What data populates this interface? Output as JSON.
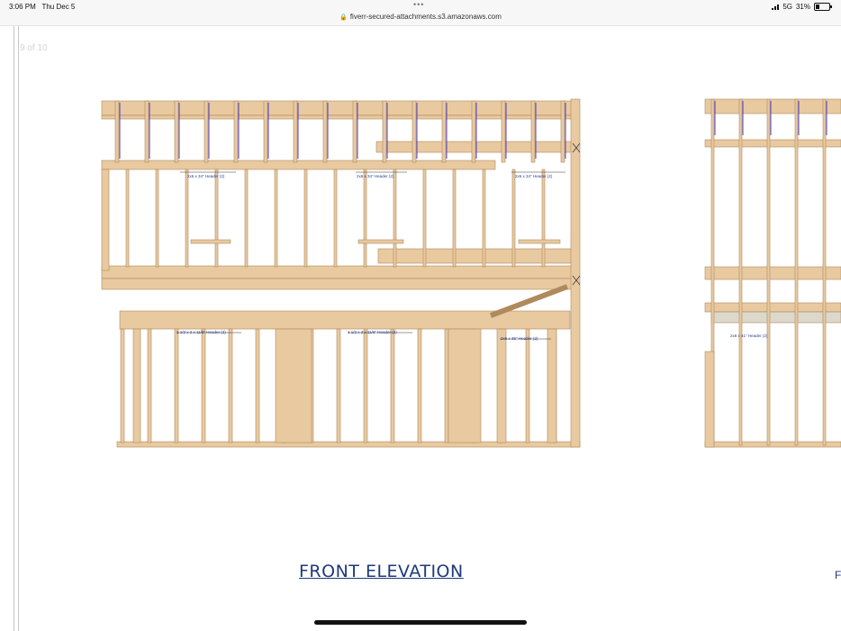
{
  "status_bar": {
    "time": "3:06 PM",
    "date": "Thu Dec 5",
    "network": "5G",
    "battery": "31%",
    "battery_level": 0.31
  },
  "browser": {
    "menu_dots": "•••",
    "url": "fiverr-secured-attachments.s3.amazonaws.com"
  },
  "document": {
    "page_indicator": "9 of 10",
    "title": "FRONT ELEVATION",
    "edge_title_fragment": "F",
    "header_labels": [
      "2x6 x 34\" Header (2)",
      "2x6 x 34\" Header (2)",
      "2x6 x 34\" Header (2)",
      "1 1/2 x 2 x 11/6\" Header (2)",
      "1 1/2 x 2 x 11/6\" Header (2)",
      "2x6 x 35\" Header (2)",
      "2x6 x 41\" Header (2)"
    ]
  },
  "colors": {
    "lumber": "#e8c9a0",
    "lumber_dark": "#b08a5c",
    "connector": "#5040c8",
    "title": "#1f3a7a"
  }
}
